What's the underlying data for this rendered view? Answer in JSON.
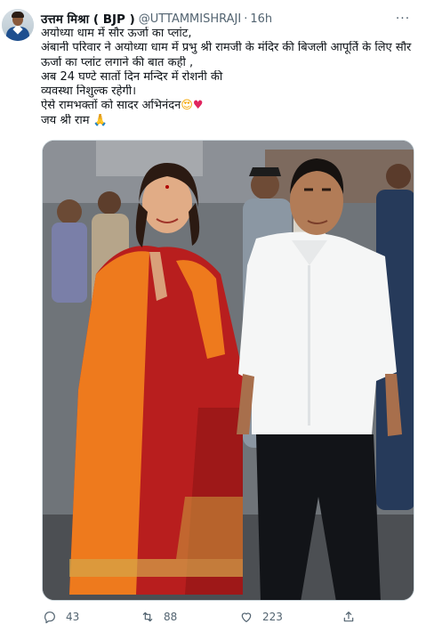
{
  "tweet": {
    "author_name": "उत्तम मिश्रा ( BJP )",
    "handle": "@UTTAMMISHRAJI",
    "separator": "·",
    "time": "16h",
    "more_label": "···",
    "text_lines": [
      "अयोध्या धाम में सौर ऊर्जा का प्लांट,",
      "अंबानी परिवार ने अयोध्या धाम में प्रभु श्री रामजी के मंदिर की बिजली आपूर्ति के लिए सौर",
      "ऊर्जा का प्लांट लगाने की बात कही ,",
      "अब 24 घण्टे सातों दिन मन्दिर में रोशनी की",
      "व्यवस्था निशुल्क रहेगी।",
      "ऐसे रामभक्तों को सादर अभिनंदन",
      "जय श्री राम"
    ],
    "emoji_smile": "😍",
    "emoji_heart": "♥",
    "emoji_pray": "🙏"
  },
  "actions": {
    "reply_count": "43",
    "retweet_count": "88",
    "like_count": "223"
  },
  "colors": {
    "secondary_text": "#536471",
    "primary_text": "#0f1419",
    "border": "#cfd9de",
    "like_red": "#e0245e"
  },
  "icons": {
    "reply": "speech-bubble-icon",
    "retweet": "retweet-icon",
    "like": "heart-outline-icon",
    "share": "share-upload-icon",
    "more": "more-horizontal-icon"
  }
}
